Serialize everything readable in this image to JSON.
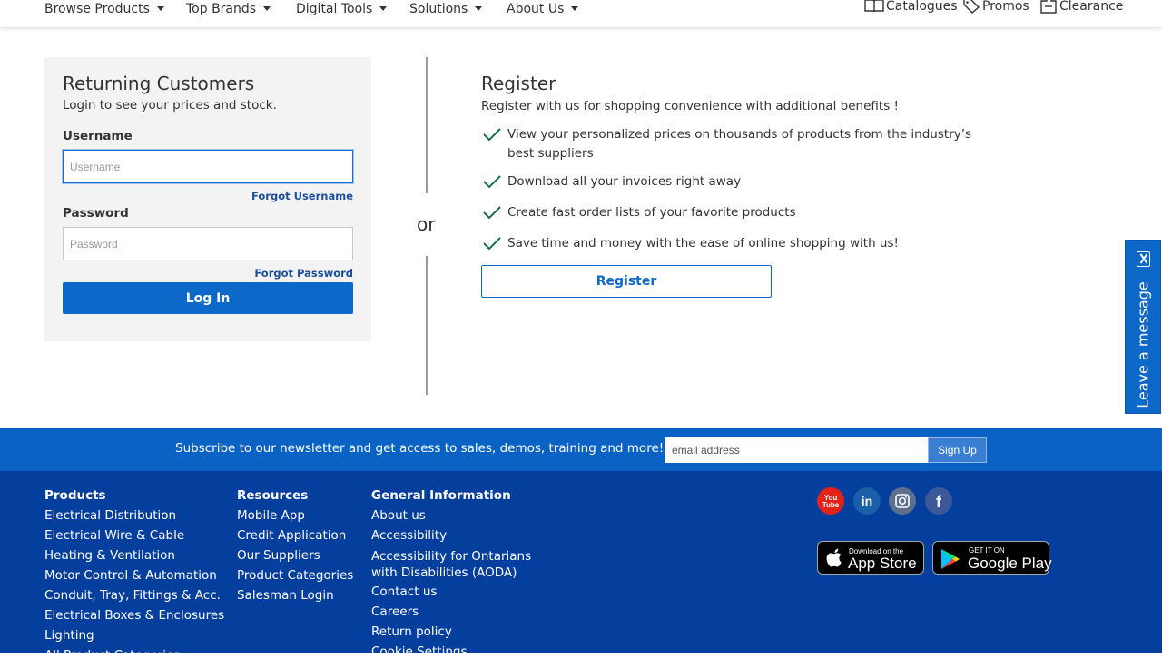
{
  "nav": {
    "items": [
      {
        "label": "Browse Products"
      },
      {
        "label": "Top Brands"
      },
      {
        "label": "Digital Tools"
      },
      {
        "label": "Solutions"
      },
      {
        "label": "About Us"
      }
    ],
    "utility": [
      {
        "label": "Catalogues",
        "icon": "open-book-icon"
      },
      {
        "label": "Promos",
        "icon": "tag-icon"
      },
      {
        "label": "Clearance",
        "icon": "clearance-tag-icon"
      }
    ]
  },
  "login": {
    "title": "Returning Customers",
    "subtitle": "Login to see your prices and stock.",
    "username_label": "Username",
    "username_placeholder": "Username",
    "forgot_username": "Forgot Username",
    "password_label": "Password",
    "password_placeholder": "Password",
    "forgot_password": "Forgot Password",
    "button": "Log In"
  },
  "divider": {
    "text": "or"
  },
  "register": {
    "title": "Register",
    "subtitle": "Register with us for shopping convenience with additional benefits !",
    "benefits": [
      "View your personalized prices on thousands of products from the industry’s best suppliers",
      "Download all your invoices right away",
      "Create fast order lists of your favorite products",
      "Save time and money with the ease of online shopping with us!"
    ],
    "button": "Register"
  },
  "chat_tab": {
    "label": "Leave a message"
  },
  "newsletter": {
    "text": "Subscribe to our newsletter and get access to sales, demos, training and more!",
    "placeholder": "email address",
    "button": "Sign Up"
  },
  "footer": {
    "products": {
      "heading": "Products",
      "links": [
        "Electrical Distribution",
        "Electrical Wire & Cable",
        "Heating & Ventilation",
        "Motor Control & Automation",
        "Conduit, Tray, Fittings & Acc.",
        "Electrical Boxes & Enclosures",
        "Lighting",
        "All Product Categories"
      ]
    },
    "resources": {
      "heading": "Resources",
      "links": [
        "Mobile App",
        "Credit Application",
        "Our Suppliers",
        "Product Categories",
        "Salesman Login"
      ]
    },
    "general": {
      "heading": "General Information",
      "links": [
        "About us",
        "Accessibility",
        "Accessibility for Ontarians with Disabilities (AODA)",
        "Contact us",
        "Careers",
        "Return policy",
        "Cookie Settings"
      ]
    },
    "social": [
      {
        "name": "youtube-icon",
        "text": "You Tube",
        "color": "#e62117"
      },
      {
        "name": "linkedin-icon",
        "text": "in",
        "color": "#0a66c2"
      },
      {
        "name": "instagram-icon",
        "color": "#8a8a8a"
      },
      {
        "name": "facebook-icon",
        "text": "f",
        "color": "#3b5998"
      }
    ],
    "app_store": {
      "small": "Download on the",
      "big": "App Store"
    },
    "google_play": {
      "small": "GET IT ON",
      "big": "Google Play"
    }
  },
  "colors": {
    "primary_blue": "#0c68c9",
    "footer_blue": "#053f9e",
    "newsletter_blue": "#0a62c4",
    "check_green": "#1f6b4f",
    "panel_gray": "#f3f3f3"
  }
}
